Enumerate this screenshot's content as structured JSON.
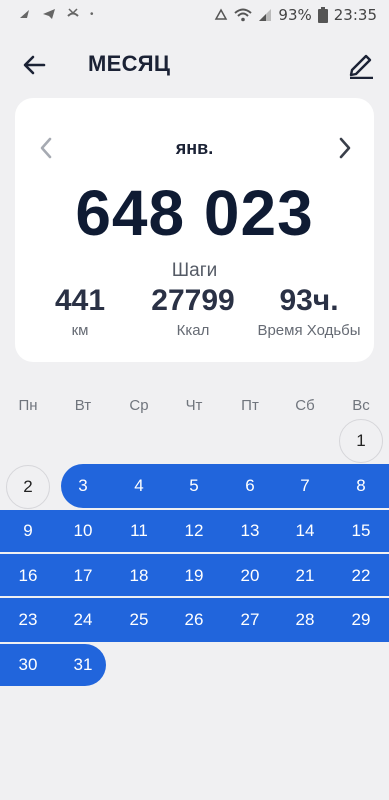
{
  "status_bar": {
    "battery": "93%",
    "time": "23:35"
  },
  "header": {
    "title": "МЕСЯЦ"
  },
  "summary": {
    "month": "янв.",
    "steps": "648 023",
    "steps_label": "Шаги",
    "distance_value": "441",
    "distance_unit": "км",
    "calories_value": "27799",
    "calories_unit": "Ккал",
    "walk_time_value": "93ч.",
    "walk_time_label": "Время Ходьбы"
  },
  "calendar": {
    "weekdays": [
      "Пн",
      "Вт",
      "Ср",
      "Чт",
      "Пт",
      "Сб",
      "Вс"
    ],
    "days": [
      "1",
      "2",
      "3",
      "4",
      "5",
      "6",
      "7",
      "8",
      "9",
      "10",
      "11",
      "12",
      "13",
      "14",
      "15",
      "16",
      "17",
      "18",
      "19",
      "20",
      "21",
      "22",
      "23",
      "24",
      "25",
      "26",
      "27",
      "28",
      "29",
      "30",
      "31"
    ],
    "highlight_color": "#2165dc"
  },
  "icons": [
    "back-arrow-icon",
    "edit-pencil-icon",
    "chevron-left-icon",
    "chevron-right-icon",
    "wifi-icon",
    "signal-icon",
    "battery-icon"
  ]
}
